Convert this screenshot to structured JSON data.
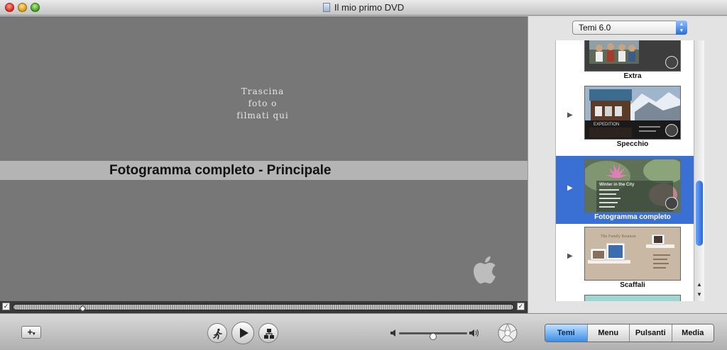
{
  "window": {
    "title": "Il mio primo DVD"
  },
  "preview": {
    "drop_hint": [
      "Trascina",
      "foto o",
      "filmati qui"
    ],
    "menu_caption": "Fotogramma completo - Principale"
  },
  "themes_panel": {
    "selector_value": "Temi 6.0",
    "themes": [
      {
        "label": "Extra",
        "selected": false
      },
      {
        "label": "Specchio",
        "selected": false
      },
      {
        "label": "Fotogramma completo",
        "selected": true
      },
      {
        "label": "Scaffali",
        "selected": false
      }
    ],
    "thumb_text": {
      "specchio_banner": "EXPEDITION",
      "fotogramma_title": "Winter in the City",
      "scaffali_title": "The Family Reunion"
    }
  },
  "toolbar": {
    "add_label": "+",
    "tabs": [
      {
        "label": "Temi",
        "active": true
      },
      {
        "label": "Menu",
        "active": false
      },
      {
        "label": "Pulsanti",
        "active": false
      },
      {
        "label": "Media",
        "active": false
      }
    ],
    "volume_level": 0.5
  },
  "colors": {
    "selection": "#3a6fd3",
    "preview_bg": "#777777",
    "caption_band": "#b4b4b4"
  },
  "icons": [
    "motion-walk-icon",
    "play-icon",
    "map-icon",
    "aperture-icon",
    "apple-logo-icon",
    "speaker-low-icon",
    "speaker-high-icon"
  ]
}
